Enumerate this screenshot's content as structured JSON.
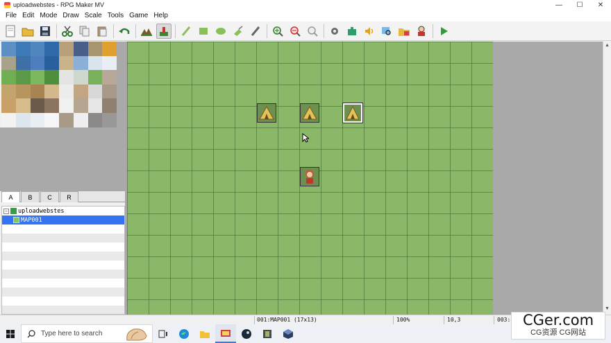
{
  "window": {
    "title": "uploadwebstes - RPG Maker MV",
    "minimize": "—",
    "maximize": "☐",
    "close": "✕"
  },
  "menu": [
    "File",
    "Edit",
    "Mode",
    "Draw",
    "Scale",
    "Tools",
    "Game",
    "Help"
  ],
  "toolbar": {
    "buttons": [
      "new-project",
      "open-project",
      "save-project",
      "cut",
      "copy",
      "paste",
      "undo",
      "map-mode",
      "event-mode",
      "pencil",
      "rectangle",
      "ellipse",
      "flood-fill",
      "shadow-pen",
      "zoom-in",
      "zoom-out",
      "actual-size",
      "database",
      "plugin-manager",
      "sound-test",
      "event-searcher",
      "resource-manager",
      "character-generator",
      "playtest"
    ]
  },
  "tileset": {
    "tabs": [
      "A",
      "B",
      "C",
      "R"
    ],
    "active_tab": "A"
  },
  "map_tree": {
    "root": "uploadwebstes",
    "items": [
      "MAP001"
    ],
    "selected": "MAP001"
  },
  "status": {
    "map": "001:MAP001 (17x13)",
    "zoom": "100%",
    "coords": "10,3",
    "extra": "003:"
  },
  "taskbar": {
    "search_placeholder": "Type here to search"
  },
  "watermark": {
    "main": "CGer.com",
    "sub": "CG资源 CG网站"
  },
  "colors": {
    "grass": "#8ab868",
    "selection": "#3574f0",
    "panel_gray": "#a9a9a9"
  }
}
